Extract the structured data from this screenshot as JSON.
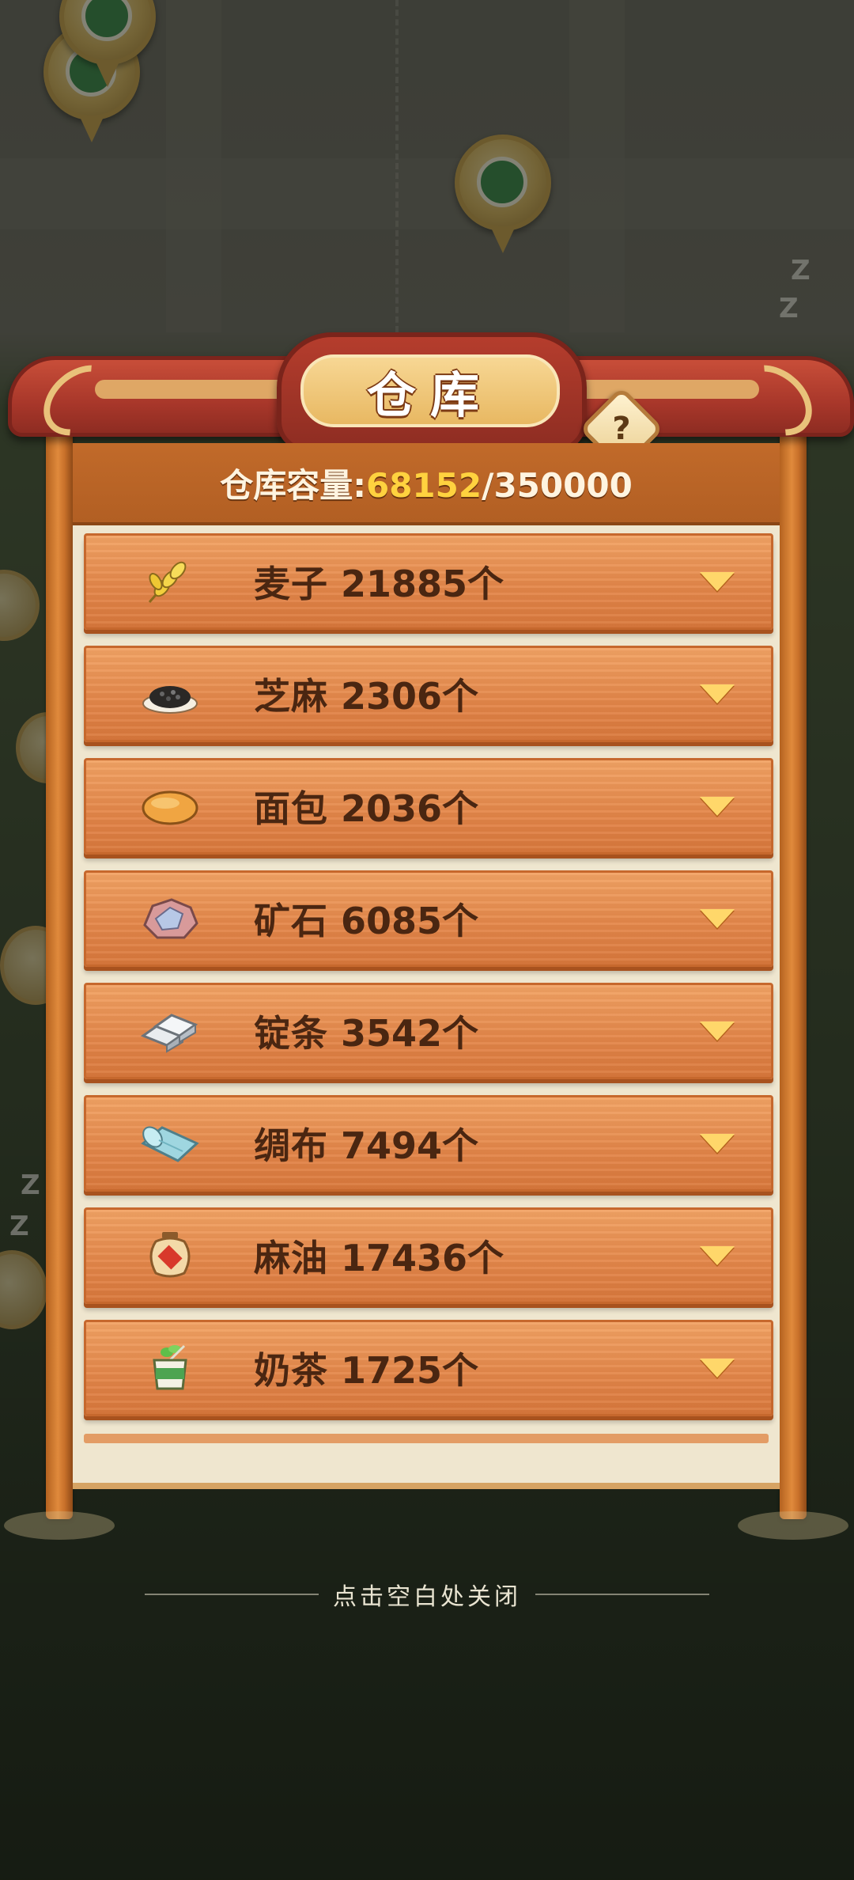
{
  "panel": {
    "title": "仓库",
    "help_symbol": "?",
    "capacity_label": "仓库容量:",
    "capacity_used": "68152",
    "capacity_separator": "/",
    "capacity_total": "350000"
  },
  "items": [
    {
      "name": "麦子",
      "count": "21885个",
      "icon": "wheat-icon"
    },
    {
      "name": "芝麻",
      "count": "2306个",
      "icon": "sesame-icon"
    },
    {
      "name": "面包",
      "count": "2036个",
      "icon": "bread-icon"
    },
    {
      "name": "矿石",
      "count": "6085个",
      "icon": "ore-icon"
    },
    {
      "name": "锭条",
      "count": "3542个",
      "icon": "ingot-icon"
    },
    {
      "name": "绸布",
      "count": "7494个",
      "icon": "silk-cloth-icon"
    },
    {
      "name": "麻油",
      "count": "17436个",
      "icon": "sesame-oil-jar-icon"
    },
    {
      "name": "奶茶",
      "count": "1725个",
      "icon": "milk-tea-icon"
    }
  ],
  "close_hint": "点击空白处关闭",
  "background_marks": [
    "Z",
    "Z",
    "Z",
    "Z"
  ],
  "colors": {
    "accent_yellow": "#ffd23f",
    "row_orange": "#e4874a",
    "roof_red": "#a8372a",
    "text_brown": "#4a2611"
  }
}
